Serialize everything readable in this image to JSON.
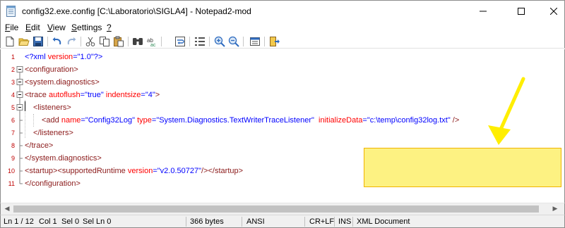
{
  "window": {
    "title": "config32.exe.config [C:\\Laboratorio\\SIGLA4] - Notepad2-mod"
  },
  "menu": {
    "file": {
      "accel": "F",
      "rest": "ile"
    },
    "edit": {
      "accel": "E",
      "rest": "dit"
    },
    "view": {
      "accel": "V",
      "rest": "iew"
    },
    "settings": {
      "accel": "S",
      "rest": "ettings"
    },
    "help": {
      "accel": "?",
      "rest": ""
    }
  },
  "toolbar": {
    "icons": [
      "new-file-icon",
      "open-folder-icon",
      "save-icon",
      "undo-icon",
      "redo-icon",
      "cut-icon",
      "copy-icon",
      "paste-icon",
      "find-icon",
      "replace-icon",
      "word-wrap-icon",
      "line-numbers-icon",
      "zoom-in-icon",
      "zoom-out-icon",
      "scheme-icon",
      "exit-icon"
    ]
  },
  "editor": {
    "line_numbers": [
      "1",
      "2",
      "3",
      "4",
      "5",
      "6",
      "7",
      "8",
      "9",
      "10",
      "11"
    ],
    "lines": [
      {
        "indent": 0,
        "segments": [
          {
            "t": "<?xml",
            "c": "tok"
          },
          {
            "t": " ",
            "c": ""
          },
          {
            "t": "version",
            "c": "attr"
          },
          {
            "t": "=",
            "c": "punc"
          },
          {
            "t": "\"1.0\"",
            "c": "val"
          },
          {
            "t": "?>",
            "c": "tok"
          }
        ]
      },
      {
        "indent": 0,
        "segments": [
          {
            "t": "<configuration>",
            "c": "tag"
          }
        ]
      },
      {
        "indent": 0,
        "segments": [
          {
            "t": "<system.diagnostics>",
            "c": "tag"
          }
        ]
      },
      {
        "indent": 0,
        "segments": [
          {
            "t": "<trace",
            "c": "tag"
          },
          {
            "t": " ",
            "c": ""
          },
          {
            "t": "autoflush",
            "c": "attr"
          },
          {
            "t": "=",
            "c": "punc"
          },
          {
            "t": "\"true\"",
            "c": "val"
          },
          {
            "t": " ",
            "c": ""
          },
          {
            "t": "indentsize",
            "c": "attr"
          },
          {
            "t": "=",
            "c": "punc"
          },
          {
            "t": "\"4\"",
            "c": "val"
          },
          {
            "t": ">",
            "c": "tag"
          }
        ]
      },
      {
        "indent": 1,
        "segments": [
          {
            "t": "<listeners>",
            "c": "tag"
          }
        ]
      },
      {
        "indent": 2,
        "segments": [
          {
            "t": "<add",
            "c": "tag"
          },
          {
            "t": " ",
            "c": ""
          },
          {
            "t": "name",
            "c": "attr"
          },
          {
            "t": "=",
            "c": "punc"
          },
          {
            "t": "\"Config32Log\"",
            "c": "val"
          },
          {
            "t": " ",
            "c": ""
          },
          {
            "t": "type",
            "c": "attr"
          },
          {
            "t": "=",
            "c": "punc"
          },
          {
            "t": "\"System.Diagnostics.TextWriterTraceListener\"",
            "c": "val"
          },
          {
            "t": "  ",
            "c": ""
          },
          {
            "t": "initializeData",
            "c": "attr"
          },
          {
            "t": "=",
            "c": "punc"
          },
          {
            "t": "\"c:\\temp\\config32log.txt\"",
            "c": "val"
          },
          {
            "t": " ",
            "c": ""
          },
          {
            "t": "/>",
            "c": "tag"
          }
        ]
      },
      {
        "indent": 1,
        "segments": [
          {
            "t": "</listeners>",
            "c": "tag"
          }
        ]
      },
      {
        "indent": 0,
        "segments": [
          {
            "t": "</trace>",
            "c": "tag"
          }
        ]
      },
      {
        "indent": 0,
        "segments": [
          {
            "t": "</system.diagnostics>",
            "c": "tag"
          }
        ]
      },
      {
        "indent": 0,
        "segments": [
          {
            "t": "<startup>",
            "c": "tag"
          },
          {
            "t": "<supportedRuntime",
            "c": "tag"
          },
          {
            "t": " ",
            "c": ""
          },
          {
            "t": "version",
            "c": "attr"
          },
          {
            "t": "=",
            "c": "punc"
          },
          {
            "t": "\"v2.0.50727\"",
            "c": "val"
          },
          {
            "t": "/></startup>",
            "c": "tag"
          }
        ]
      },
      {
        "indent": 0,
        "segments": [
          {
            "t": "</configuration>",
            "c": "tag"
          }
        ]
      }
    ]
  },
  "status": {
    "ln": "Ln 1 / 12",
    "col": "Col 1",
    "sel": "Sel 0",
    "sel_ln": "Sel Ln 0",
    "size": "366 bytes",
    "encoding": "ANSI",
    "eol": "CR+LF",
    "ovr": "INS",
    "lexer": "XML Document"
  },
  "colors": {
    "tag": "#8b1a1a",
    "attribute": "#ff0000",
    "value": "#0000ff",
    "highlight_fill": "#fdf282",
    "highlight_border": "#f0b400",
    "arrow": "#ffee00",
    "line_number": "#c00000"
  }
}
